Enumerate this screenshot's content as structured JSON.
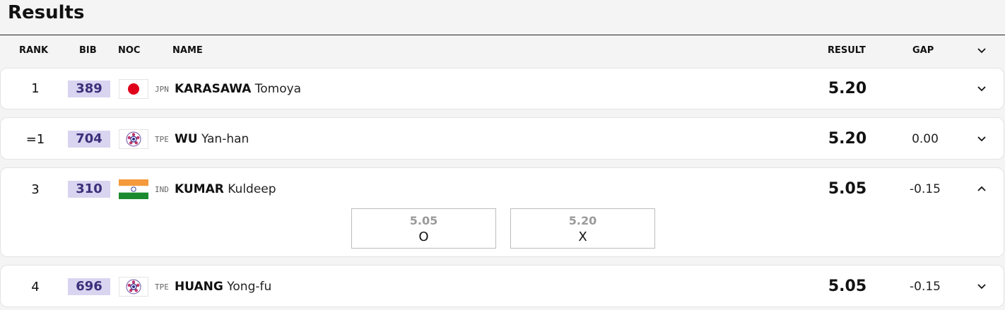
{
  "page": {
    "title": "Results"
  },
  "table": {
    "headers": {
      "rank": "RANK",
      "bib": "BIB",
      "noc": "NOC",
      "name": "NAME",
      "result": "RESULT",
      "gap": "GAP"
    },
    "rows": [
      {
        "rank": "1",
        "bib": "389",
        "noc": "JPN",
        "flag_icon": "japan-flag-icon",
        "surname": "KARASAWA",
        "given_name": "Tomoya",
        "result": "5.20",
        "gap": "",
        "expanded": false
      },
      {
        "rank": "=1",
        "bib": "704",
        "noc": "TPE",
        "flag_icon": "chinese-taipei-flag-icon",
        "surname": "WU",
        "given_name": "Yan-han",
        "result": "5.20",
        "gap": "0.00",
        "expanded": false
      },
      {
        "rank": "3",
        "bib": "310",
        "noc": "IND",
        "flag_icon": "india-flag-icon",
        "surname": "KUMAR",
        "given_name": "Kuldeep",
        "result": "5.05",
        "gap": "-0.15",
        "expanded": true,
        "attempts": [
          {
            "height": "5.05",
            "mark": "O"
          },
          {
            "height": "5.20",
            "mark": "X"
          }
        ]
      },
      {
        "rank": "4",
        "bib": "696",
        "noc": "TPE",
        "flag_icon": "chinese-taipei-flag-icon",
        "surname": "HUANG",
        "given_name": "Yong-fu",
        "result": "5.05",
        "gap": "-0.15",
        "expanded": false
      }
    ]
  },
  "colors": {
    "bib_background": "#d9d4f0",
    "bib_text": "#3b2f7a",
    "page_background": "#f4f4f4"
  }
}
